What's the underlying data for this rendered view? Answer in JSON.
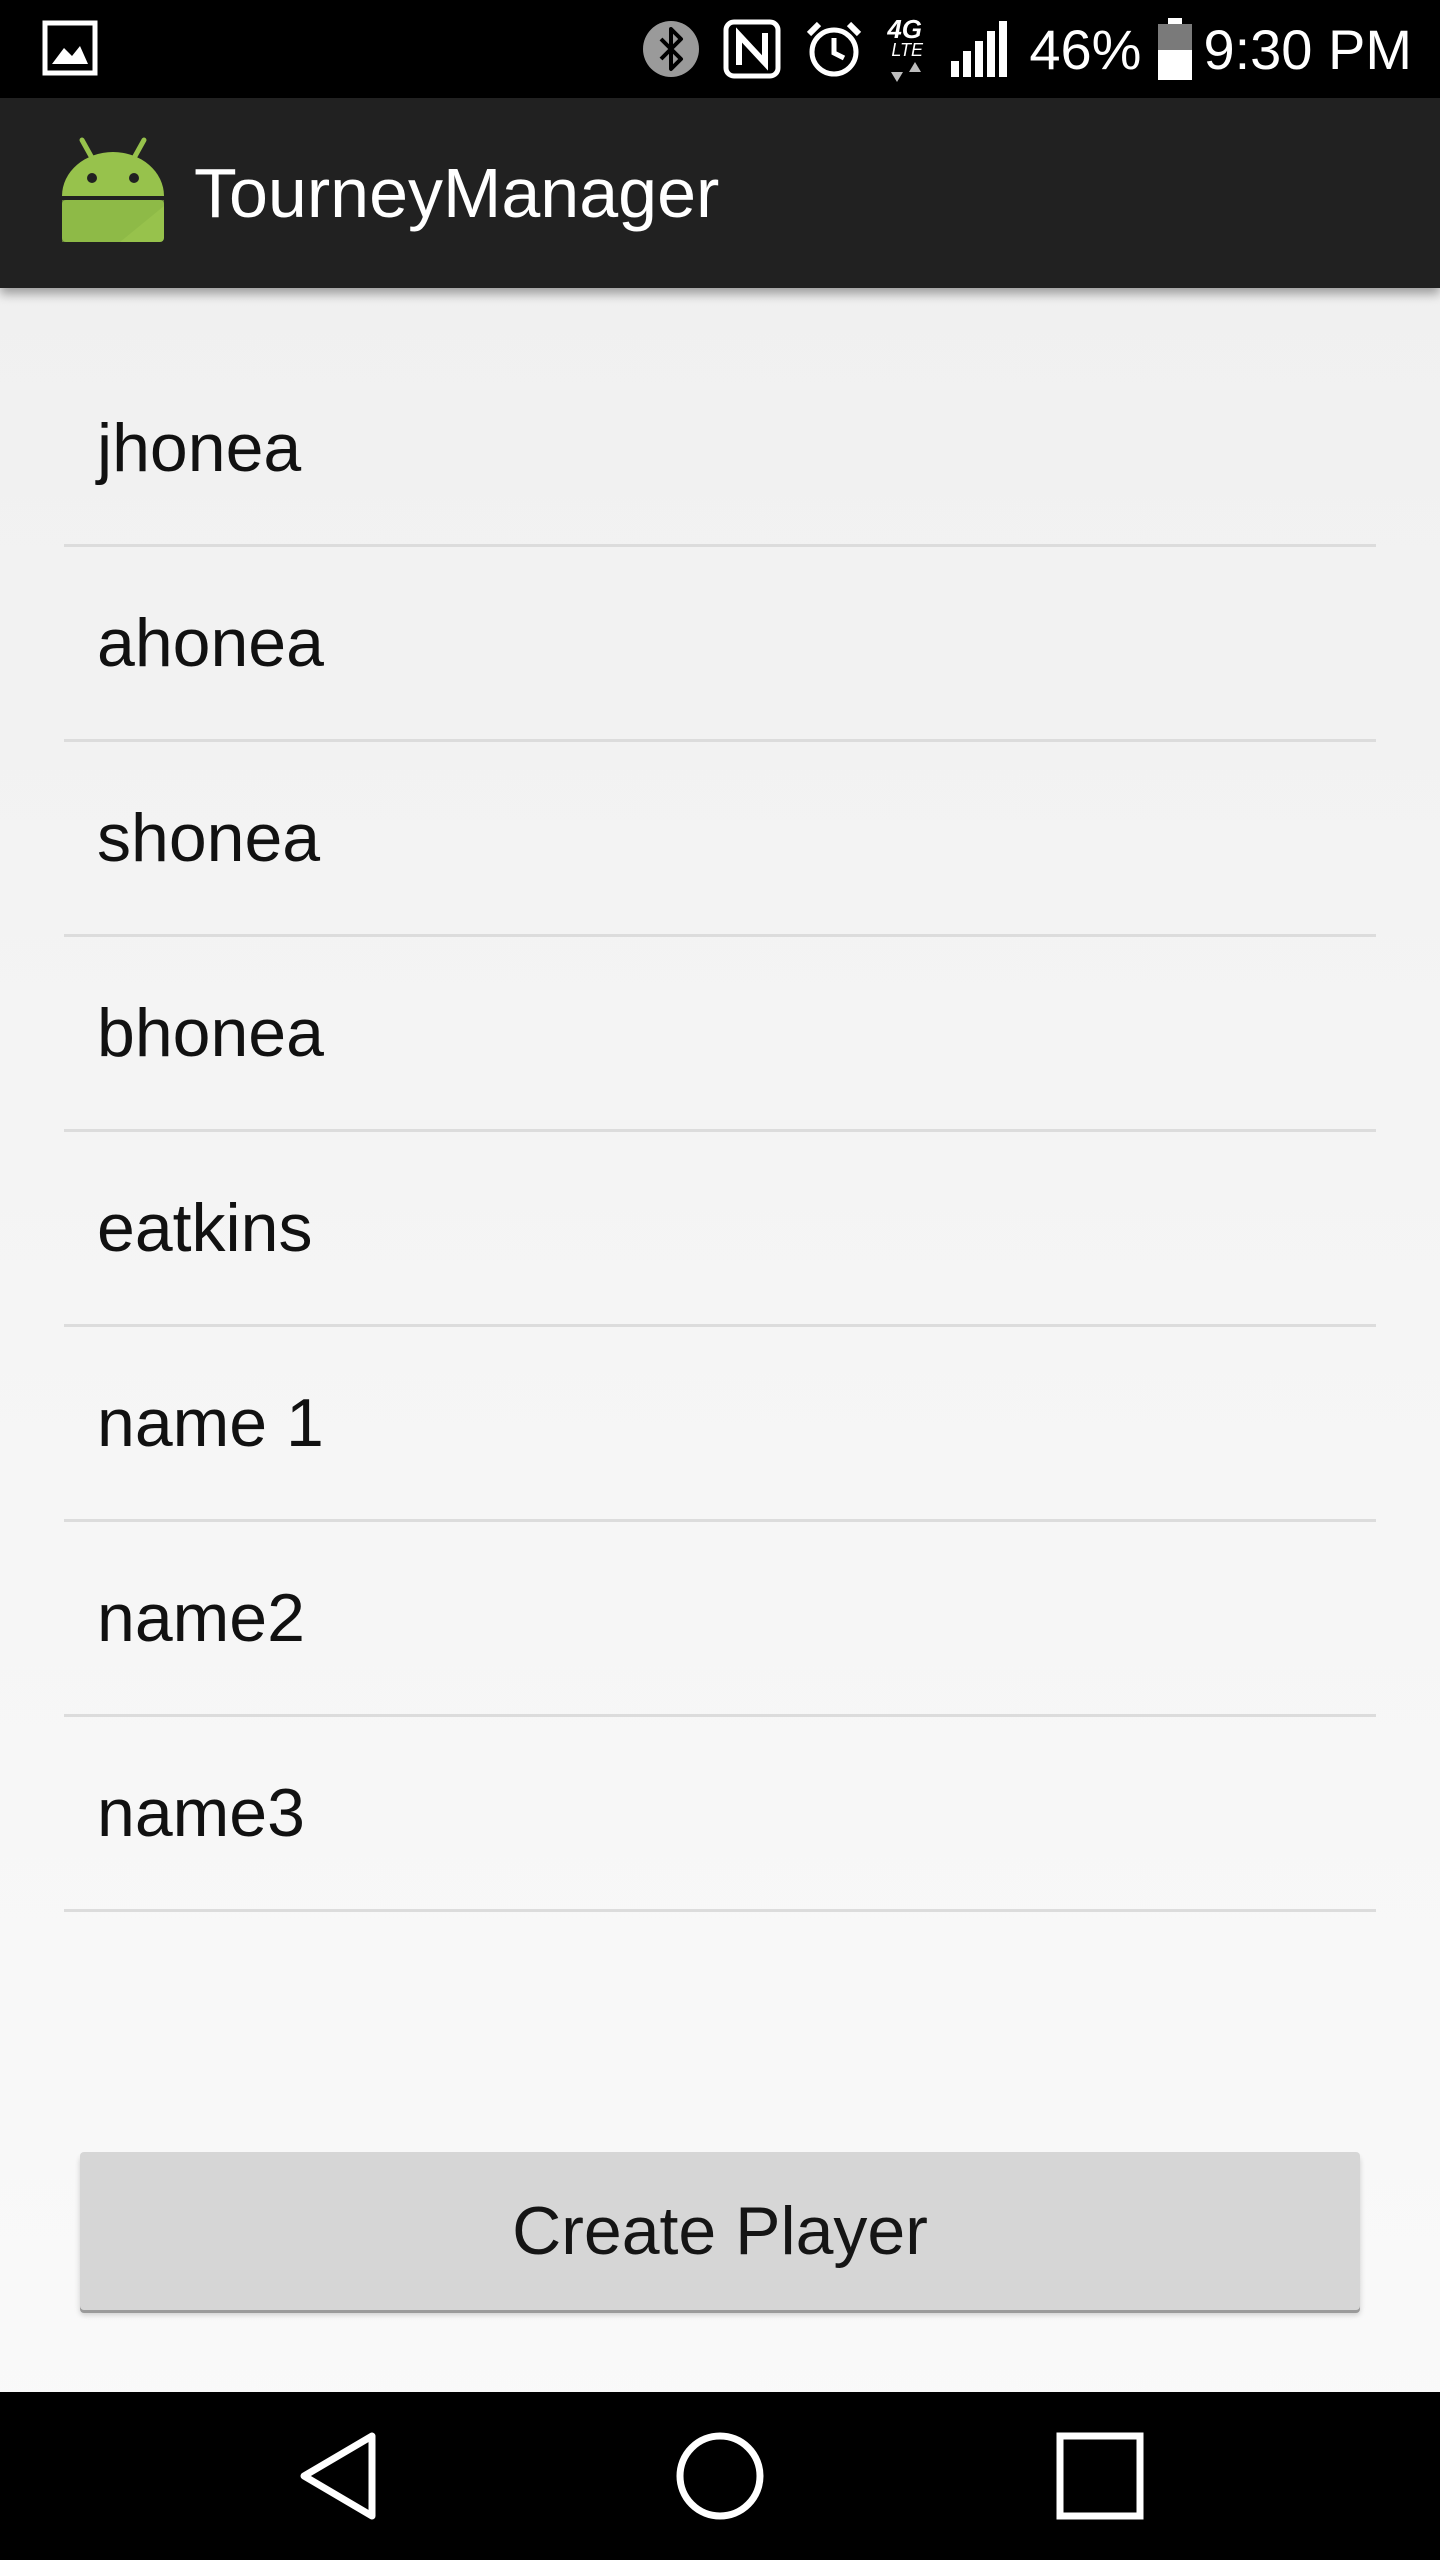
{
  "status_bar": {
    "battery_percent": "46%",
    "time": "9:30 PM",
    "network_type": "4G",
    "network_sub": "LTE",
    "icons": [
      "gallery-icon",
      "bluetooth-icon",
      "nfc-icon",
      "alarm-icon",
      "network-4g-lte-icon",
      "signal-icon",
      "battery-icon"
    ]
  },
  "app_bar": {
    "title": "TourneyManager",
    "icon": "android-app-icon",
    "bar_color": "#212121",
    "icon_color": "#97c24c"
  },
  "players": [
    {
      "name": "jhonea"
    },
    {
      "name": "ahonea"
    },
    {
      "name": "shonea"
    },
    {
      "name": "bhonea"
    },
    {
      "name": "eatkins"
    },
    {
      "name": "name 1"
    },
    {
      "name": "name2"
    },
    {
      "name": "name3"
    }
  ],
  "create_button": {
    "label": "Create Player",
    "color": "#d6d6d6"
  },
  "nav_bar": {
    "buttons": [
      "back-icon",
      "home-icon",
      "recents-icon"
    ]
  }
}
